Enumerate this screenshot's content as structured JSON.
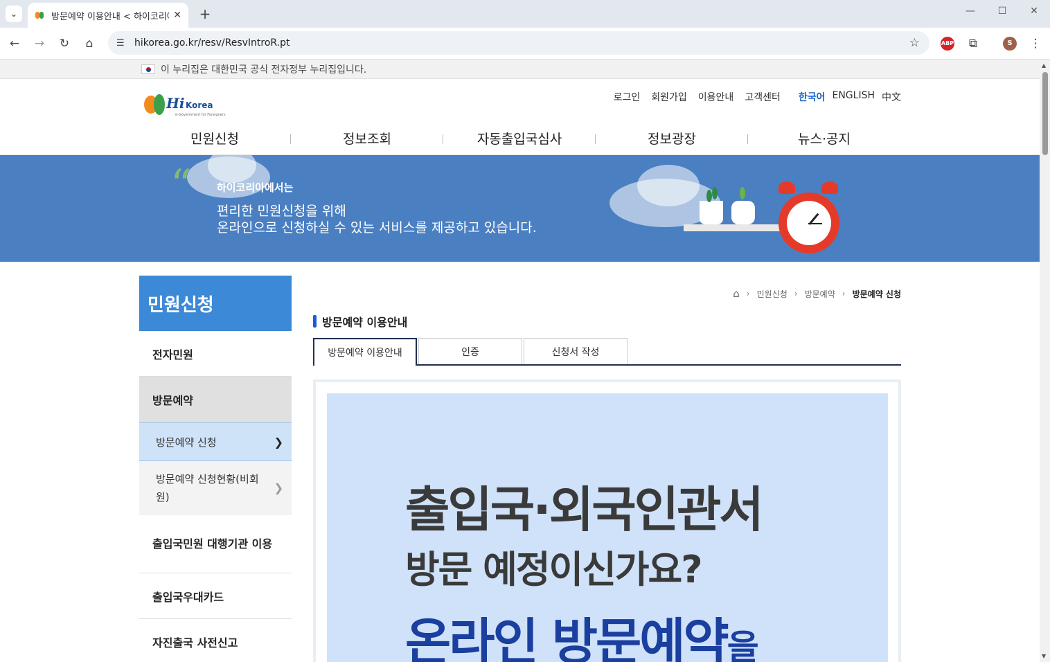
{
  "browser": {
    "tab_title": "방문예약 이용안내 < 하이코리아",
    "url": "hikorea.go.kr/resv/ResvIntroR.pt",
    "profile_initial": "S",
    "ext_abp": "ABP"
  },
  "gov_notice": "이 누리집은 대한민국 공식 전자정부 누리집입니다.",
  "logo": {
    "hi": "Hi",
    "korea": "Korea",
    "sub": "e-Government for Foreigners"
  },
  "utility_links": [
    "로그인",
    "회원가입",
    "이용안내",
    "고객센터"
  ],
  "languages": [
    "한국어",
    "ENGLISH",
    "中文"
  ],
  "gnb": [
    "민원신청",
    "정보조회",
    "자동출입국심사",
    "정보광장",
    "뉴스·공지"
  ],
  "banner": {
    "small": "하이코리아에서는",
    "line1": "편리한 민원신청을 위해",
    "line2": "온라인으로 신청하실 수 있는 서비스를 제공하고 있습니다."
  },
  "lnb": {
    "title": "민원신청",
    "items": [
      "전자민원",
      "방문예약"
    ],
    "subs": [
      "방문예약 신청",
      "방문예약 신청현황(비회원)"
    ],
    "more": [
      "출입국민원 대행기관 이용",
      "출입국우대카드",
      "자진출국 사전신고"
    ]
  },
  "breadcrumb": [
    "민원신청",
    "방문예약",
    "방문예약 신청"
  ],
  "page_title": "방문예약 이용안내",
  "tabs": [
    "방문예약 이용안내",
    "인증",
    "신청서 작성"
  ],
  "poster": {
    "line1": "출입국·외국인관서",
    "line2": "방문 예정이신가요?",
    "line3": "온라인 방문예약",
    "line3_suffix": "을"
  }
}
